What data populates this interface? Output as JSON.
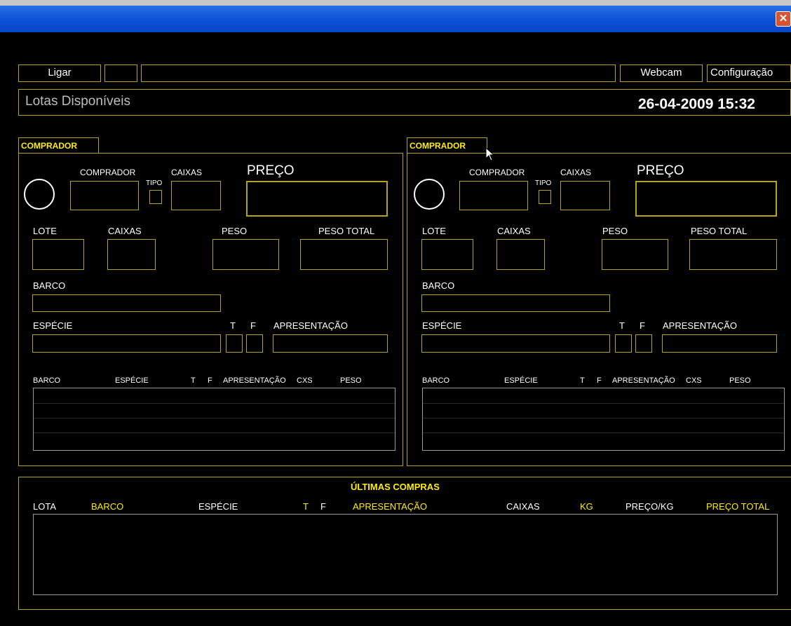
{
  "window": {
    "close_glyph": "✕"
  },
  "toolbar": {
    "ligar_label": "Ligar",
    "webcam_label": "Webcam",
    "config_label": "Configuração"
  },
  "header": {
    "title": "Lotas Disponíveis",
    "datetime": "26-04-2009 15:32"
  },
  "panels": [
    {
      "tab_label": "COMPRADOR",
      "comprador_label": "COMPRADOR",
      "tipo_label": "TIPO",
      "caixas_label": "CAIXAS",
      "preco_label": "PREÇO",
      "lote_label": "LOTE",
      "caixas2_label": "CAIXAS",
      "peso_label": "PESO",
      "peso_total_label": "PESO TOTAL",
      "barco_label": "BARCO",
      "especie_label": "ESPÉCIE",
      "t_label": "T",
      "f_label": "F",
      "apresentacao_label": "APRESENTAÇÃO",
      "columns": [
        "BARCO",
        "ESPÉCIE",
        "T",
        "F",
        "APRESENTAÇÃO",
        "CXS",
        "PESO"
      ]
    },
    {
      "tab_label": "COMPRADOR",
      "comprador_label": "COMPRADOR",
      "tipo_label": "TIPO",
      "caixas_label": "CAIXAS",
      "preco_label": "PREÇO",
      "lote_label": "LOTE",
      "caixas2_label": "CAIXAS",
      "peso_label": "PESO",
      "peso_total_label": "PESO TOTAL",
      "barco_label": "BARCO",
      "especie_label": "ESPÉCIE",
      "t_label": "T",
      "f_label": "F",
      "apresentacao_label": "APRESENTAÇÃO",
      "columns": [
        "BARCO",
        "ESPÉCIE",
        "T",
        "F",
        "APRESENTAÇÃO",
        "CXS",
        "PESO"
      ]
    }
  ],
  "ultimas": {
    "title": "ÚLTIMAS COMPRAS",
    "columns": [
      "LOTA",
      "BARCO",
      "ESPÉCIE",
      "T",
      "F",
      "APRESENTAÇÃO",
      "CAIXAS",
      "KG",
      "PREÇO/KG",
      "PREÇO TOTAL"
    ]
  },
  "colors": {
    "border": "#b5a31f",
    "accent_yellow": "#ffee00",
    "titlebar": "#0a4fd6"
  }
}
